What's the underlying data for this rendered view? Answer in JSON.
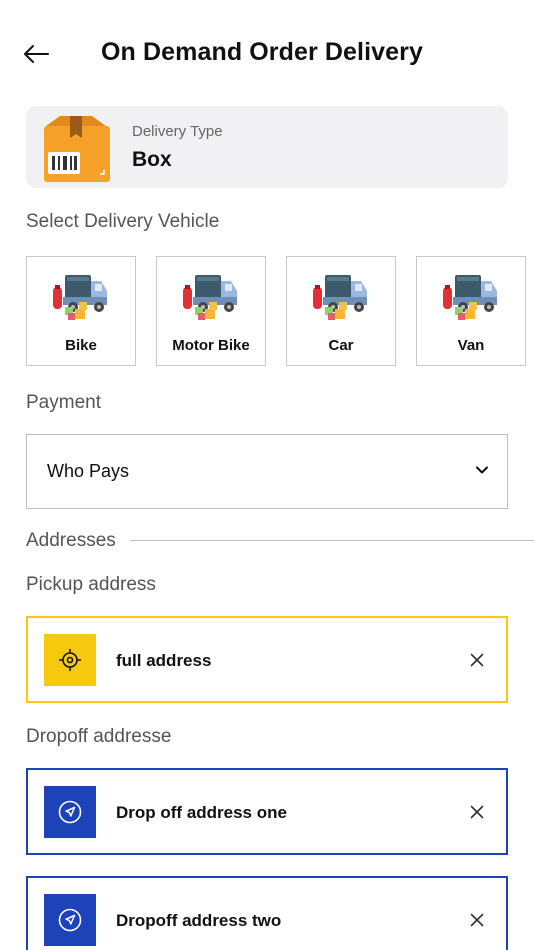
{
  "header": {
    "title": "On Demand Order Delivery"
  },
  "delivery": {
    "type_label": "Delivery Type",
    "type_value": "Box"
  },
  "vehicles": {
    "section_label": "Select Delivery Vehicle",
    "items": [
      {
        "label": "Bike"
      },
      {
        "label": "Motor Bike"
      },
      {
        "label": "Car"
      },
      {
        "label": "Van"
      }
    ]
  },
  "payment": {
    "section_label": "Payment",
    "selected": "Who Pays"
  },
  "addresses": {
    "section_label": "Addresses",
    "pickup_label": "Pickup address",
    "pickup_value": "full address",
    "dropoff_label": "Dropoff addresse",
    "dropoffs": [
      {
        "value": "Drop off address one"
      },
      {
        "value": "Dropoff address two"
      }
    ]
  },
  "colors": {
    "pickup_accent": "#f6c90e",
    "dropoff_accent": "#1c44b8",
    "card_bg": "#f1f0f2"
  }
}
